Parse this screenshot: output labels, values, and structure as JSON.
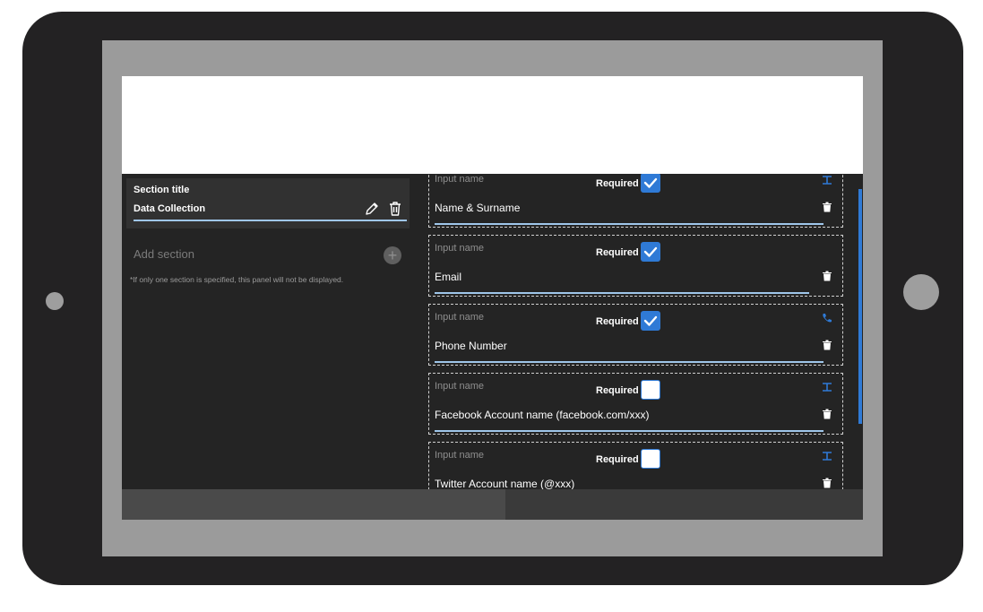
{
  "left_panel": {
    "section_title_label": "Section title",
    "section_title_value": "Data Collection",
    "add_section_label": "Add section",
    "add_icon": "+",
    "note": "*If only one section is specified, this panel will not be displayed."
  },
  "fields": [
    {
      "label": "Input name",
      "required_label": "Required",
      "required": true,
      "value": "Name & Surname",
      "type_icon": "text-icon"
    },
    {
      "label": "Input name",
      "required_label": "Required",
      "required": true,
      "value": "Email",
      "type_icon": "none"
    },
    {
      "label": "Input name",
      "required_label": "Required",
      "required": true,
      "value": "Phone Number",
      "type_icon": "phone-icon"
    },
    {
      "label": "Input name",
      "required_label": "Required",
      "required": false,
      "value": "Facebook Account name (facebook.com/xxx)",
      "type_icon": "text-icon"
    },
    {
      "label": "Input name",
      "required_label": "Required",
      "required": false,
      "value": "Twitter Account name (@xxx)",
      "type_icon": "text-icon"
    }
  ],
  "colors": {
    "accent": "#2f7ad6",
    "underline": "#9fc6ea",
    "panel": "#242424",
    "card": "#313131"
  }
}
